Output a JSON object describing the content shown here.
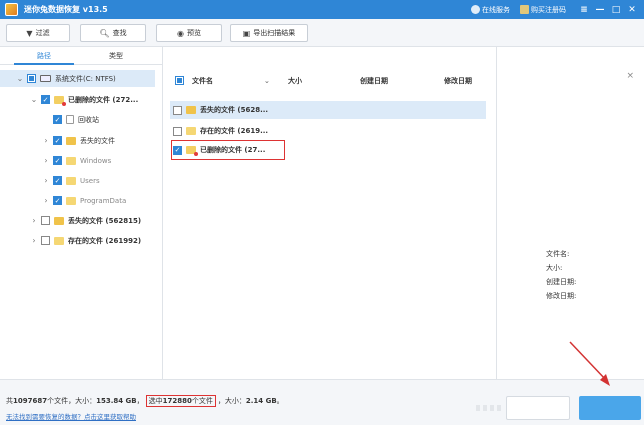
{
  "window": {
    "title": "迷你兔数据恢复 v13.5",
    "online_service": "在线服务",
    "buy_register": "购买注册码",
    "controls": [
      "≡",
      "—",
      "□",
      "✕"
    ]
  },
  "toolbar": {
    "filter": "过滤",
    "find": "查找",
    "preview": "预览",
    "export": "导出扫描结果"
  },
  "left": {
    "tabs": [
      "路径",
      "类型"
    ],
    "tree": [
      {
        "label": "系统文件(C: NTFS)"
      },
      {
        "label": "已删除的文件 (272..."
      },
      {
        "label": "回收站"
      },
      {
        "label": "丢失的文件"
      },
      {
        "label": "Windows"
      },
      {
        "label": "Users"
      },
      {
        "label": "ProgramData"
      },
      {
        "label": "丢失的文件 (562815)"
      },
      {
        "label": "存在的文件 (261992)"
      }
    ]
  },
  "list": {
    "columns": [
      "文件名",
      "大小",
      "创建日期",
      "修改日期"
    ],
    "rows": [
      {
        "name": "丢失的文件 (5628..."
      },
      {
        "name": "存在的文件 (2619..."
      },
      {
        "name": "已删除的文件 (27..."
      }
    ]
  },
  "preview": {
    "close": "×",
    "fields": [
      "文件名:",
      "大小:",
      "创建日期:",
      "修改日期:"
    ]
  },
  "status": {
    "prefix": "共",
    "total_files": "1097687",
    "files_unit": "个文件，大小：",
    "total_size": "153.84 GB",
    "sep": "，",
    "selected_prefix": "选中",
    "selected_count": "172880",
    "selected_unit": "个文件",
    "size_label": "，大小：",
    "selected_size": "2.14 GB",
    "end": "。",
    "help_link": "无法找到需要恢复的数据？点击这里获取帮助"
  },
  "colors": {
    "accent": "#2f86d6",
    "highlight": "#dceaf8",
    "annotation": "#d33333",
    "primary_button": "#4aa6ea"
  }
}
